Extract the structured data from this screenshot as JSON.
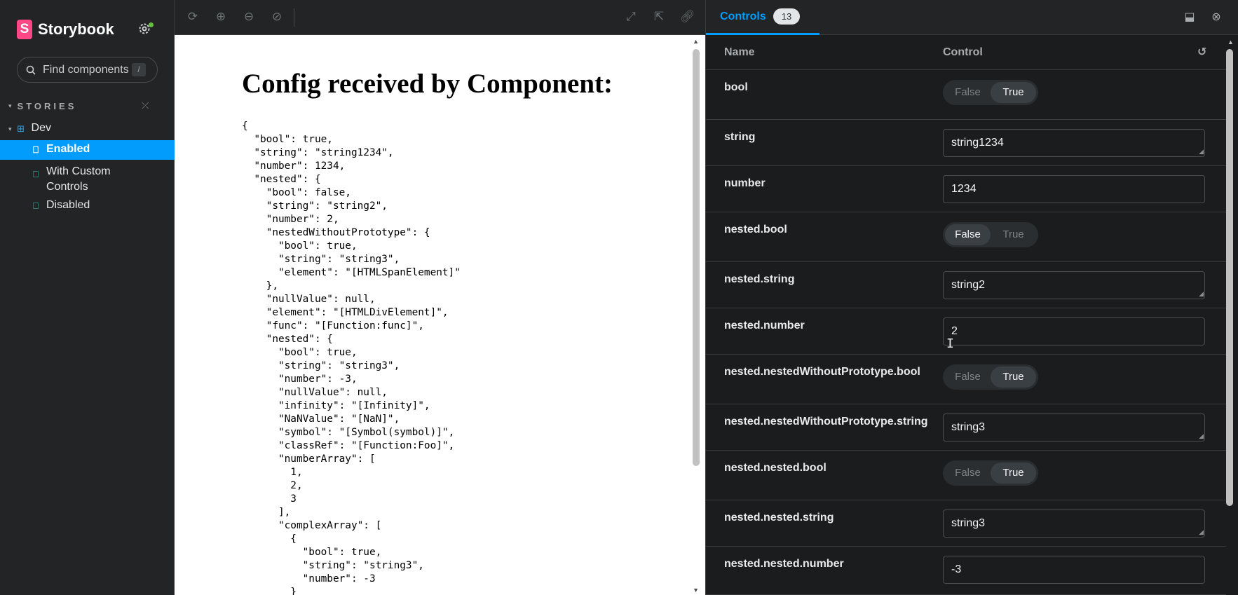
{
  "sidebar": {
    "brand": "Storybook",
    "search_placeholder": "Find components",
    "search_shortcut": "/",
    "stories_heading": "STORIES",
    "group": "Dev",
    "items": [
      {
        "label": "Enabled",
        "active": true
      },
      {
        "label": "With Custom Controls",
        "active": false
      },
      {
        "label": "Disabled",
        "active": false
      }
    ]
  },
  "preview": {
    "title": "Config received by Component:",
    "json_text": "{\n  \"bool\": true,\n  \"string\": \"string1234\",\n  \"number\": 1234,\n  \"nested\": {\n    \"bool\": false,\n    \"string\": \"string2\",\n    \"number\": 2,\n    \"nestedWithoutPrototype\": {\n      \"bool\": true,\n      \"string\": \"string3\",\n      \"element\": \"[HTMLSpanElement]\"\n    },\n    \"nullValue\": null,\n    \"element\": \"[HTMLDivElement]\",\n    \"func\": \"[Function:func]\",\n    \"nested\": {\n      \"bool\": true,\n      \"string\": \"string3\",\n      \"number\": -3,\n      \"nullValue\": null,\n      \"infinity\": \"[Infinity]\",\n      \"NaNValue\": \"[NaN]\",\n      \"symbol\": \"[Symbol(symbol)]\",\n      \"classRef\": \"[Function:Foo]\",\n      \"numberArray\": [\n        1,\n        2,\n        3\n      ],\n      \"complexArray\": [\n        {\n          \"bool\": true,\n          \"string\": \"string3\",\n          \"number\": -3\n        }"
  },
  "panel": {
    "tab_label": "Controls",
    "tab_count": "13",
    "col_name": "Name",
    "col_control": "Control",
    "false_label": "False",
    "true_label": "True",
    "rows": [
      {
        "name": "bool",
        "type": "boolean",
        "value": true
      },
      {
        "name": "string",
        "type": "text",
        "value": "string1234"
      },
      {
        "name": "number",
        "type": "number",
        "value": "1234"
      },
      {
        "name": "nested.bool",
        "type": "boolean",
        "value": false
      },
      {
        "name": "nested.string",
        "type": "text",
        "value": "string2"
      },
      {
        "name": "nested.number",
        "type": "number",
        "value": "2"
      },
      {
        "name": "nested.nestedWithoutPrototype.bool",
        "type": "boolean",
        "value": true
      },
      {
        "name": "nested.nestedWithoutPrototype.string",
        "type": "text",
        "value": "string3"
      },
      {
        "name": "nested.nested.bool",
        "type": "boolean",
        "value": true
      },
      {
        "name": "nested.nested.string",
        "type": "text",
        "value": "string3"
      },
      {
        "name": "nested.nested.number",
        "type": "number",
        "value": "-3"
      }
    ]
  },
  "colors": {
    "accent": "#029cfd",
    "brand": "#ff4785",
    "story_icon": "#38d6c9"
  }
}
